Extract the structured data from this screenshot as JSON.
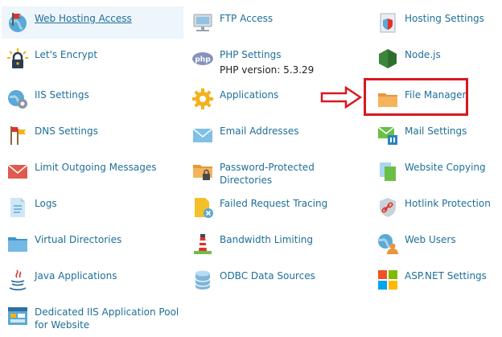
{
  "items": [
    {
      "key": "web-hosting-access",
      "label": "Web Hosting Access",
      "icon": "globe-flag-icon"
    },
    {
      "key": "ftp-access",
      "label": "FTP Access",
      "icon": "ftp-monitor-icon"
    },
    {
      "key": "hosting-settings",
      "label": "Hosting Settings",
      "icon": "shield-document-icon"
    },
    {
      "key": "lets-encrypt",
      "label": "Let's Encrypt",
      "icon": "lock-sun-icon"
    },
    {
      "key": "php-settings",
      "label": "PHP Settings",
      "icon": "php-icon",
      "sub": "PHP version: 5.3.29"
    },
    {
      "key": "nodejs",
      "label": "Node.js",
      "icon": "nodejs-hexagon-icon"
    },
    {
      "key": "iis-settings",
      "label": "IIS Settings",
      "icon": "globe-gear-icon"
    },
    {
      "key": "applications",
      "label": "Applications",
      "icon": "gear-icon"
    },
    {
      "key": "file-manager",
      "label": "File Manager",
      "icon": "folder-icon"
    },
    {
      "key": "dns-settings",
      "label": "DNS Settings",
      "icon": "flags-icon"
    },
    {
      "key": "email-addresses",
      "label": "Email Addresses",
      "icon": "envelope-icon"
    },
    {
      "key": "mail-settings",
      "label": "Mail Settings",
      "icon": "mail-settings-icon"
    },
    {
      "key": "limit-outgoing-messages",
      "label": "Limit Outgoing Messages",
      "icon": "red-envelope-icon"
    },
    {
      "key": "password-protected-directories",
      "label": "Password-Protected Directories",
      "icon": "locked-folder-icon"
    },
    {
      "key": "website-copying",
      "label": "Website Copying",
      "icon": "copy-pages-icon"
    },
    {
      "key": "logs",
      "label": "Logs",
      "icon": "log-document-icon"
    },
    {
      "key": "failed-request-tracing",
      "label": "Failed Request Tracing",
      "icon": "failed-trace-icon"
    },
    {
      "key": "hotlink-protection",
      "label": "Hotlink Protection",
      "icon": "link-shield-icon"
    },
    {
      "key": "virtual-directories",
      "label": "Virtual Directories",
      "icon": "blue-folder-icon"
    },
    {
      "key": "bandwidth-limiting",
      "label": "Bandwidth Limiting",
      "icon": "lighthouse-icon"
    },
    {
      "key": "web-users",
      "label": "Web Users",
      "icon": "globe-user-icon"
    },
    {
      "key": "java-applications",
      "label": "Java Applications",
      "icon": "java-cup-icon"
    },
    {
      "key": "odbc-data-sources",
      "label": "ODBC Data Sources",
      "icon": "database-icon"
    },
    {
      "key": "aspnet-settings",
      "label": "ASP.NET Settings",
      "icon": "windows-logo-icon"
    },
    {
      "key": "dedicated-iis-application-pool",
      "label": "Dedicated IIS Application Pool for Website",
      "icon": "app-pool-icon"
    }
  ],
  "highlight": {
    "target": "File Manager",
    "color": "#d71920"
  }
}
